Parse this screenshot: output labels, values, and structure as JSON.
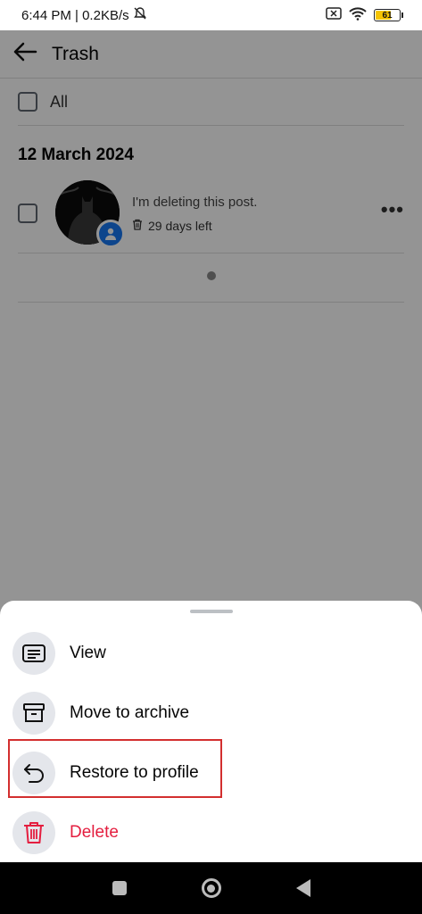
{
  "status_bar": {
    "time_speed": "6:44 PM | 0.2KB/s",
    "battery": "61"
  },
  "header": {
    "title": "Trash"
  },
  "select_all": {
    "label": "All"
  },
  "posts": {
    "date_heading": "12 March 2024",
    "items": [
      {
        "text": "I'm deleting this post.",
        "days_left": "29 days left"
      }
    ]
  },
  "sheet": {
    "items": [
      {
        "label": "View",
        "icon": "view-icon"
      },
      {
        "label": "Move to archive",
        "icon": "archive-icon"
      },
      {
        "label": "Restore to profile",
        "icon": "restore-icon"
      },
      {
        "label": "Delete",
        "icon": "trash-icon"
      }
    ]
  },
  "colors": {
    "delete": "#e41e3f",
    "highlight": "#d32f2f",
    "badge": "#1877f2"
  }
}
